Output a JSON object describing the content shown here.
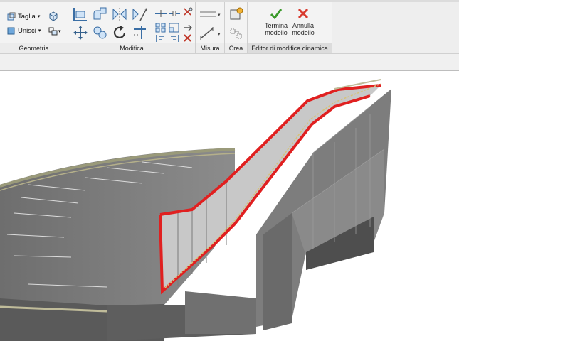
{
  "ribbon": {
    "geometria": {
      "title": "Geometria",
      "taglia": "Taglia",
      "unisci": "Unisci"
    },
    "modifica": {
      "title": "Modifica"
    },
    "misura": {
      "title": "Misura"
    },
    "crea": {
      "title": "Crea"
    },
    "editor": {
      "title": "Editor di modifica dinamica",
      "finish_label": "Termina modello",
      "cancel_label": "Annulla modello"
    }
  },
  "colors": {
    "finish": "#3a9a2a",
    "cancel": "#d83a2e",
    "highlight": "#e02020"
  },
  "icons": [
    "cut-icon",
    "join-icon",
    "align-icon",
    "offset-icon",
    "mirror-icon",
    "move-icon",
    "copy-icon",
    "rotate-icon",
    "trim-icon",
    "array-icon",
    "scale-icon",
    "pin-icon",
    "unpin-icon",
    "delete-icon",
    "measure-icon",
    "dimension-icon",
    "create-icon",
    "check-icon",
    "x-icon"
  ]
}
